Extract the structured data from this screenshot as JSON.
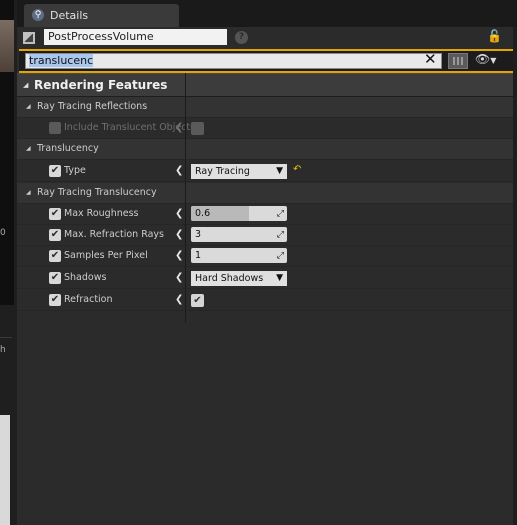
{
  "tab": {
    "title": "Details"
  },
  "object": {
    "name": "PostProcessVolume"
  },
  "search": {
    "value": "translucenc"
  },
  "category": {
    "label": "Rendering Features"
  },
  "sections": {
    "reflections": {
      "label": "Ray Tracing Reflections"
    },
    "translucency": {
      "label": "Translucency"
    },
    "rt_translucency": {
      "label": "Ray Tracing Translucency"
    }
  },
  "props": {
    "include_translucent": {
      "label": "Include Translucent Objects",
      "enabled": false,
      "value": false
    },
    "type": {
      "label": "Type",
      "value": "Ray Tracing",
      "overridden": true
    },
    "max_roughness": {
      "label": "Max Roughness",
      "value": "0.6",
      "fraction": 0.6
    },
    "max_refraction_rays": {
      "label": "Max. Refraction Rays",
      "value": "3"
    },
    "samples_per_pixel": {
      "label": "Samples Per Pixel",
      "value": "1"
    },
    "shadows": {
      "label": "Shadows",
      "value": "Hard Shadows"
    },
    "refraction": {
      "label": "Refraction",
      "value": true
    }
  },
  "left_fragments": [
    "0",
    "h"
  ],
  "colors": {
    "accent": "#e5a400",
    "panel": "#2b2b2b",
    "category": "#3c3c3c"
  }
}
